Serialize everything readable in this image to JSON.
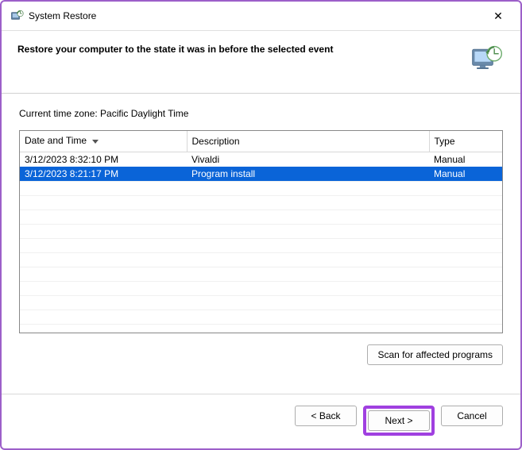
{
  "titlebar": {
    "title": "System Restore",
    "close_label": "✕"
  },
  "header": {
    "heading": "Restore your computer to the state it was in before the selected event"
  },
  "timezone_label": "Current time zone: Pacific Daylight Time",
  "columns": {
    "date": "Date and Time",
    "desc": "Description",
    "type": "Type"
  },
  "rows": [
    {
      "date": "3/12/2023 8:32:10 PM",
      "desc": "Vivaldi",
      "type": "Manual",
      "selected": false
    },
    {
      "date": "3/12/2023 8:21:17 PM",
      "desc": "Program install",
      "type": "Manual",
      "selected": true
    }
  ],
  "buttons": {
    "scan": "Scan for affected programs",
    "back": "< Back",
    "next": "Next >",
    "cancel": "Cancel"
  }
}
